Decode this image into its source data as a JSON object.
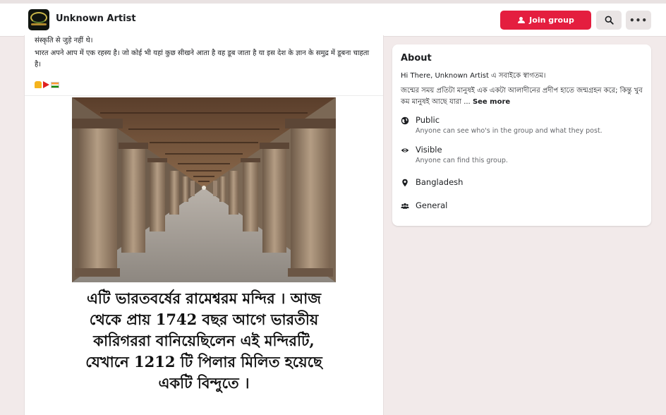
{
  "header": {
    "group_name": "Unknown Artist",
    "join_label": "Join group",
    "more_label": "•••"
  },
  "post": {
    "text_line_0": "संस्कृति से जुड़े नहीं थे।",
    "text_line_1": " भारत अपने आप में एक रहस्य है।  जो कोई भी यहां कुछ सीखने आता है वह डूब जाता है या इस देश के ज्ञान के समुद्र में डूबना चाहता है।",
    "image_caption_lines": [
      "এটি ভারতবর্ষের রামেশ্বরম মন্দির । আজ",
      "থেকে প্রায় 1742 বছর আগে ভারতীয়",
      "কারিগররা বানিয়েছিলেন এই মন্দিরটি,",
      "যেখানে 1212 টি পিলার মিলিত হয়েছে",
      "একটি বিন্দুতে ।"
    ]
  },
  "about": {
    "title": "About",
    "greeting": "Hi There, Unknown Artist এ সবাইকে স্বাগতম।",
    "description": "জন্মের সময় প্রতিটা মানুষই এক একটা আলাদীনের প্রদীপ হাতে জন্মগ্রহন করে; কিন্তু খুব কম মানুষই আছে যারা ...",
    "see_more": "See more",
    "privacy_label": "Public",
    "privacy_sub": "Anyone can see who's in the group and what they post.",
    "visibility_label": "Visible",
    "visibility_sub": "Anyone can find this group.",
    "location": "Bangladesh",
    "category": "General"
  },
  "colors": {
    "accent": "#e41e3f",
    "page_bg": "#f2eaea"
  }
}
